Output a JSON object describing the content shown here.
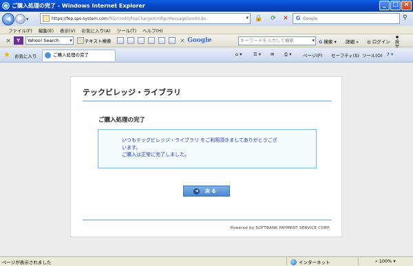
{
  "window": {
    "title": "ご購入処理の完了 - Windows Internet Explorer"
  },
  "address": {
    "url_prefix": "https://",
    "url_host": "fep.sps-system.com",
    "url_path": "/f02/credit/FepChargeXmlRpcMessageSendd.do",
    "search_placeholder": "Google"
  },
  "menu": [
    "ファイル(F)",
    "編集(E)",
    "表示(V)",
    "お気に入り(A)",
    "ツール(T)",
    "ヘルプ(H)"
  ],
  "toolbar2": {
    "yahoo_select": "Yahoo! Search",
    "text_search": "テキスト検索",
    "google_logo": "Google",
    "google_placeholder": "キーワードを入力して検索",
    "search_btn": "検索",
    "more": "詳細 »",
    "login": "ログイン",
    "settings_line1": "設",
    "settings_line2": "定"
  },
  "tabs": {
    "favorites": "お気に入り",
    "active_tab": "ご購入処理の完了",
    "page_menu": "ページ(P)",
    "safety_menu": "セーフティ(S)",
    "tools_menu": "ツール(O)"
  },
  "page": {
    "brand": "テックビレッジ・ライブラリ",
    "heading": "ご購入処理の完了",
    "message_line1": "いつもテックビレッジ・ライブラリ をご利用頂きましてありがとうござ",
    "message_line2": "います。",
    "message_line3": "ご購入は正常に完了しました。",
    "back_button": "戻る",
    "powered_by": "Powered by SOFTBANK PAYMENT SERVICE CORP."
  },
  "status": {
    "text": "ページが表示されました",
    "zone": "インターネット",
    "zoom": "100%"
  }
}
